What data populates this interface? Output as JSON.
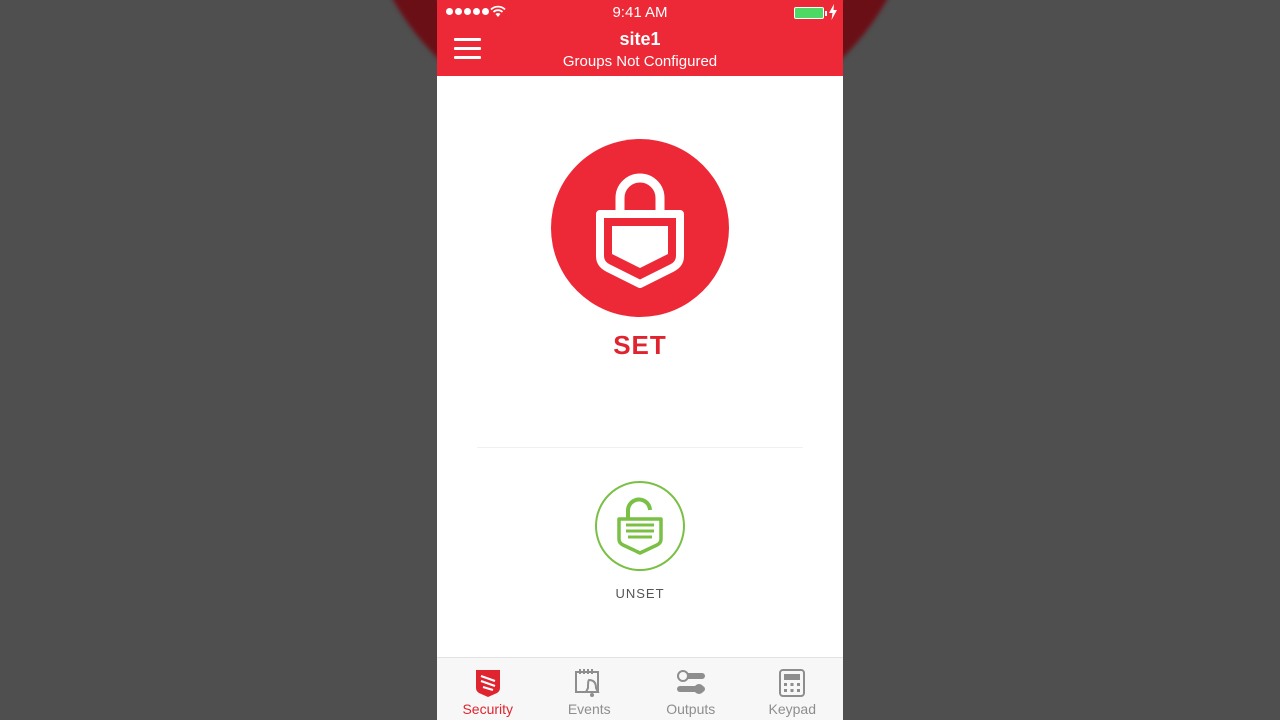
{
  "status_bar": {
    "time": "9:41 AM"
  },
  "header": {
    "title": "site1",
    "subtitle": "Groups Not Configured"
  },
  "main": {
    "set_label": "SET",
    "unset_label": "UNSET"
  },
  "tabs": [
    {
      "label": "Security",
      "icon": "shield-icon",
      "active": true
    },
    {
      "label": "Events",
      "icon": "calendar-bell-icon",
      "active": false
    },
    {
      "label": "Outputs",
      "icon": "toggles-icon",
      "active": false
    },
    {
      "label": "Keypad",
      "icon": "keypad-icon",
      "active": false
    }
  ],
  "colors": {
    "brand_red": "#ed2837",
    "unset_green": "#79c045",
    "tab_inactive": "#8e8e8e"
  }
}
